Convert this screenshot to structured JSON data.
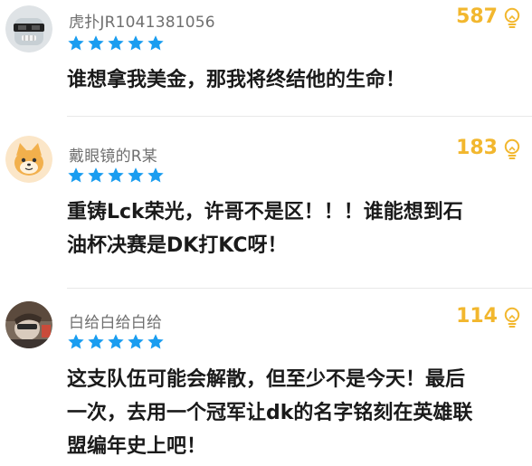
{
  "comments": [
    {
      "username": "虎扑JR1041381056",
      "likes": "587",
      "content_lines": [
        "谁想拿我美金，那我将终结他的生命！"
      ]
    },
    {
      "username": "戴眼镜的R某",
      "likes": "183",
      "content_lines": [
        "重铸Lck荣光，许哥不是区！！！谁能想到石",
        "油杯决赛是DK打KC呀！"
      ]
    },
    {
      "username": "白给白给白给",
      "likes": "114",
      "content_lines": [
        "这支队伍可能会解散，但至少不是今天！最后",
        "一次，去用一个冠军让dk的名字铭刻在英雄联",
        "盟编年史上吧！"
      ]
    }
  ],
  "colors": {
    "likes": "#f2b72e",
    "stars": "#1a9df0",
    "username": "#6f6f6f",
    "content": "#1a1a1a"
  },
  "icons": {
    "star": "star-icon",
    "like": "lightbulb-icon"
  },
  "rating_stars": 5
}
